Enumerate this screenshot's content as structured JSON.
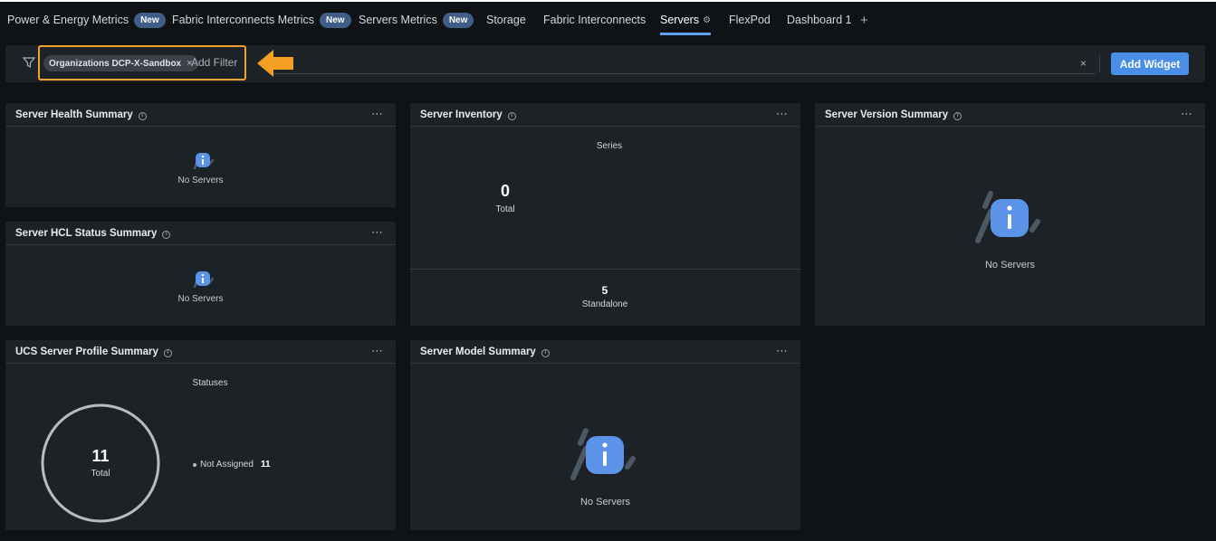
{
  "tabs": [
    {
      "label": "Power & Energy Metrics",
      "badge": "New"
    },
    {
      "label": "Fabric Interconnects Metrics",
      "badge": "New"
    },
    {
      "label": "Servers Metrics",
      "badge": "New"
    },
    {
      "label": "Storage"
    },
    {
      "label": "Fabric Interconnects"
    },
    {
      "label": "Servers",
      "active": true
    },
    {
      "label": "FlexPod"
    },
    {
      "label": "Dashboard 1"
    },
    {
      "label": "+"
    }
  ],
  "filter": {
    "chip_label": "Organizations DCP-X-Sandbox",
    "chip_remove": "×",
    "add_filter": "Add Filter",
    "clear": "×",
    "add_widget": "Add Widget"
  },
  "widgets": {
    "health": {
      "title": "Server Health Summary",
      "empty": "No Servers"
    },
    "hcl": {
      "title": "Server HCL Status Summary",
      "empty": "No Servers"
    },
    "inventory": {
      "title": "Server Inventory",
      "series_label": "Series",
      "total_value": "0",
      "total_label": "Total",
      "standalone_value": "5",
      "standalone_label": "Standalone"
    },
    "version": {
      "title": "Server Version Summary",
      "empty": "No Servers"
    },
    "profile": {
      "title": "UCS Server Profile Summary",
      "statuses_label": "Statuses",
      "total_value": "11",
      "total_label": "Total",
      "legend_label": "Not Assigned",
      "legend_value": "11",
      "not_assigned_fraction": 1.0
    },
    "model": {
      "title": "Server Model Summary",
      "empty": "No Servers"
    }
  },
  "icons": {
    "menu": "⋯",
    "info": "i"
  },
  "colors": {
    "accent": "#4a8ee8",
    "highlight": "#f0a030",
    "badge": "#3f5d86",
    "info_icon": "#5b93e8"
  }
}
